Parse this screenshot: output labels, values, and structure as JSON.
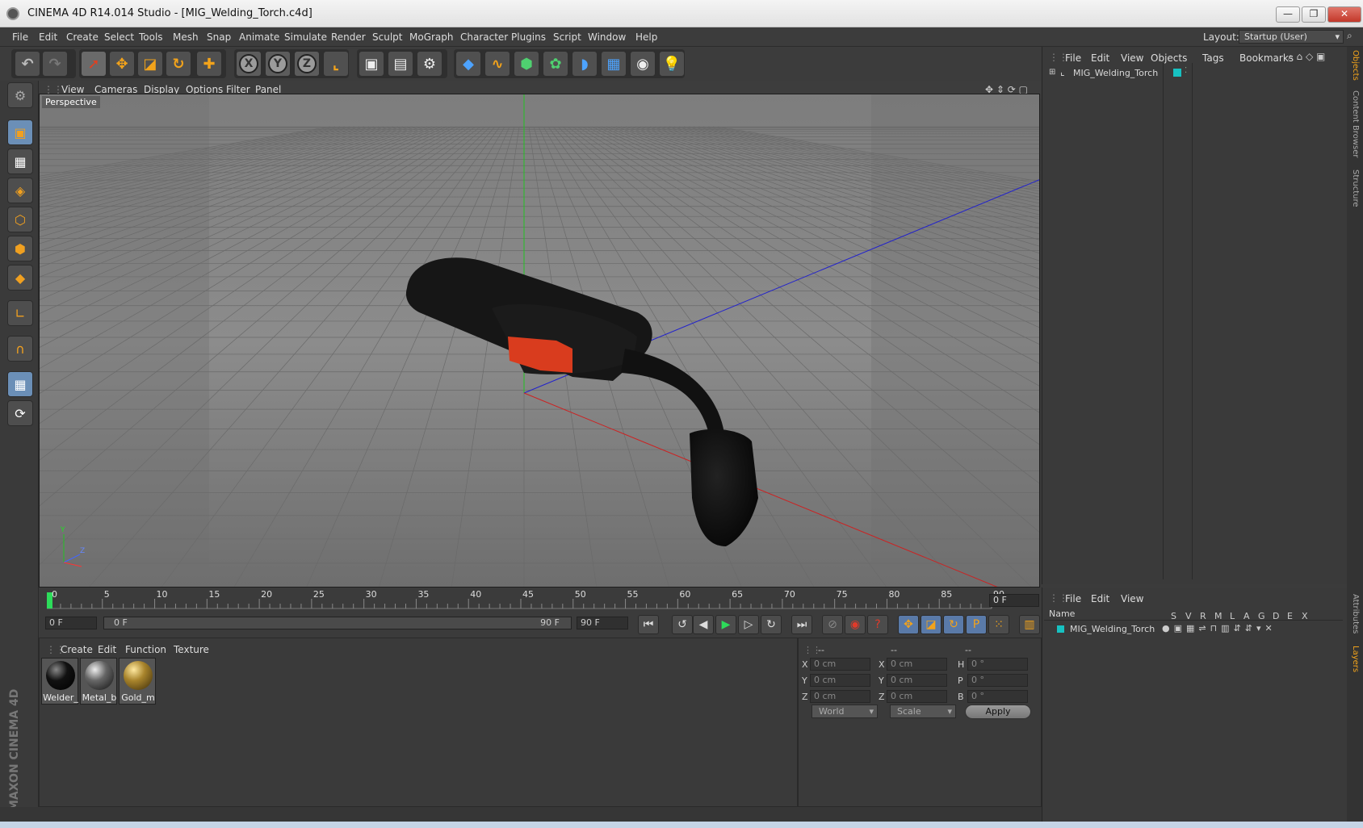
{
  "window": {
    "title": "CINEMA 4D R14.014 Studio - [MIG_Welding_Torch.c4d]",
    "minimize": "—",
    "restore": "❐",
    "close": "✕"
  },
  "menubar": {
    "items": [
      "File",
      "Edit",
      "Create",
      "Select",
      "Tools",
      "Mesh",
      "Snap",
      "Animate",
      "Simulate",
      "Render",
      "Sculpt",
      "MoGraph",
      "Character",
      "Plugins",
      "Script",
      "Window",
      "Help"
    ],
    "layout_label": "Layout:",
    "layout_value": "Startup (User)"
  },
  "viewport": {
    "menu": [
      "View",
      "Cameras",
      "Display",
      "Options",
      "Filter",
      "Panel"
    ],
    "label": "Perspective",
    "axis_y": "Y",
    "axis_z": "Z"
  },
  "timeline": {
    "ticks": [
      "0",
      "5",
      "10",
      "15",
      "20",
      "25",
      "30",
      "35",
      "40",
      "45",
      "50",
      "55",
      "60",
      "65",
      "70",
      "75",
      "80",
      "85",
      "90"
    ],
    "current_frame": "0 F",
    "start_field": "0 F",
    "range_start": "0 F",
    "range_end": "90 F",
    "end_field": "90 F"
  },
  "materials": {
    "menu": [
      "Create",
      "Edit",
      "Function",
      "Texture"
    ],
    "items": [
      {
        "label": "Welder_",
        "color": "#111111"
      },
      {
        "label": "Metal_b",
        "color": "#777777"
      },
      {
        "label": "Gold_m",
        "color": "#a8842c"
      }
    ]
  },
  "coordinates": {
    "headers": [
      "--",
      "--",
      "--"
    ],
    "rows": [
      {
        "l1": "X",
        "v1": "0 cm",
        "l2": "X",
        "v2": "0 cm",
        "l3": "H",
        "v3": "0 °"
      },
      {
        "l1": "Y",
        "v1": "0 cm",
        "l2": "Y",
        "v2": "0 cm",
        "l3": "P",
        "v3": "0 °"
      },
      {
        "l1": "Z",
        "v1": "0 cm",
        "l2": "Z",
        "v2": "0 cm",
        "l3": "B",
        "v3": "0 °"
      }
    ],
    "mode_world": "World",
    "mode_scale": "Scale",
    "apply": "Apply"
  },
  "objects": {
    "menu": [
      "File",
      "Edit",
      "View",
      "Objects",
      "Tags",
      "Bookmarks"
    ],
    "tree": [
      {
        "name": "MIG_Welding_Torch"
      }
    ]
  },
  "layers": {
    "menu": [
      "File",
      "Edit",
      "View"
    ],
    "name_header": "Name",
    "columns": [
      "S",
      "V",
      "R",
      "M",
      "L",
      "A",
      "G",
      "D",
      "E",
      "X"
    ],
    "rows": [
      {
        "name": "MIG_Welding_Torch"
      }
    ]
  },
  "side_tabs": [
    "Objects",
    "Content Browser",
    "Structure",
    "Attributes",
    "Layers"
  ],
  "brand": "MAXON CINEMA 4D",
  "colors": {
    "accent_orange": "#f2a31b",
    "trigger_red": "#d93c1e",
    "axis_green": "#22c222",
    "axis_blue": "#2222cc",
    "axis_red": "#cc2222"
  }
}
